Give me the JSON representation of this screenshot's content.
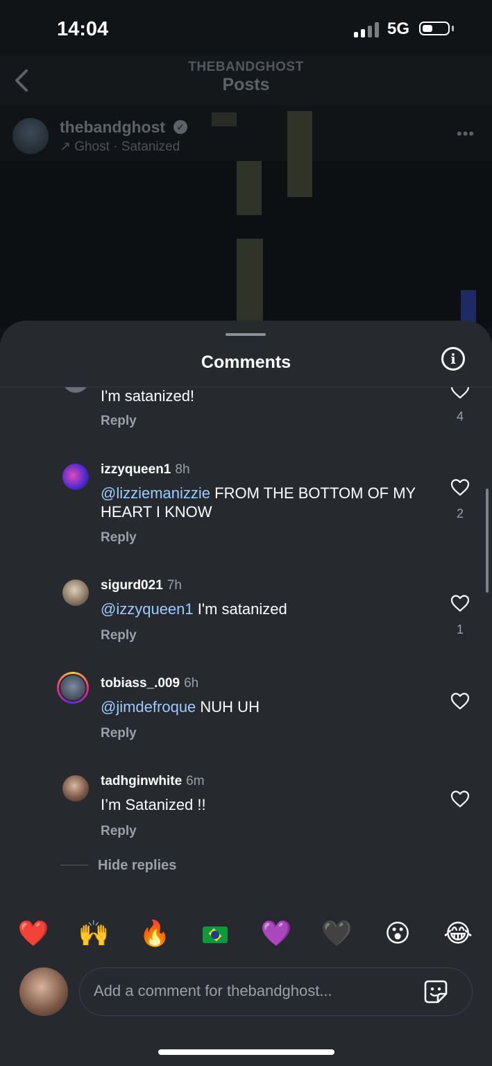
{
  "status": {
    "time": "14:04",
    "network": "5G"
  },
  "nav": {
    "subtitle": "THEBANDGHOST",
    "title": "Posts"
  },
  "post": {
    "username": "thebandghost",
    "music": "↗ Ghost · Satanized"
  },
  "sheet": {
    "title": "Comments"
  },
  "comments": [
    {
      "username": "",
      "time": "",
      "text": "I'm satanized!",
      "mention": "",
      "reply": "Reply",
      "likes": "4"
    },
    {
      "username": "izzyqueen1",
      "time": "8h",
      "mention": "@lizziemanizzie",
      "text": " FROM THE BOTTOM OF MY HEART I KNOW",
      "reply": "Reply",
      "likes": "2"
    },
    {
      "username": "sigurd021",
      "time": "7h",
      "mention": "@izzyqueen1",
      "text": " I'm satanized",
      "reply": "Reply",
      "likes": "1"
    },
    {
      "username": "tobiass_.009",
      "time": "6h",
      "mention": "@jimdefroque",
      "text": " NUH UH",
      "reply": "Reply",
      "likes": ""
    },
    {
      "username": "tadhginwhite",
      "time": "6m",
      "mention": "",
      "text": "I’m Satanized !!",
      "reply": "Reply",
      "likes": ""
    }
  ],
  "hide_replies": "Hide replies",
  "emojis": [
    "❤️",
    "🙌",
    "🔥",
    "brazil-flag",
    "💜",
    "🖤",
    "😮",
    "😂"
  ],
  "composer": {
    "placeholder": "Add a comment for thebandghost..."
  },
  "colors": {
    "sheet_bg": "#262a2f",
    "mention": "#9ccbff",
    "muted": "#9aa0a6"
  }
}
